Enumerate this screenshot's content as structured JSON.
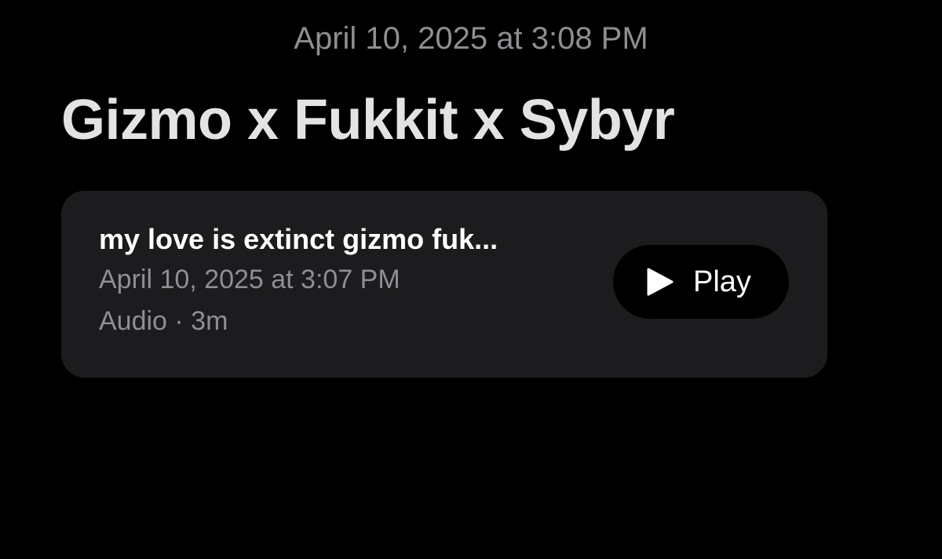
{
  "header": {
    "timestamp": "April 10, 2025 at 3:08 PM"
  },
  "note": {
    "title": "Gizmo x Fukkit x Sybyr"
  },
  "attachment": {
    "title": "my love is extinct gizmo fuk...",
    "date": "April 10, 2025 at 3:07 PM",
    "meta": "Audio · 3m",
    "play_label": "Play",
    "play_icon": "play-icon"
  },
  "colors": {
    "background": "#000000",
    "card": "#1c1c1e",
    "secondary_text": "#8e8e93",
    "title_text": "#e3e3e3"
  }
}
